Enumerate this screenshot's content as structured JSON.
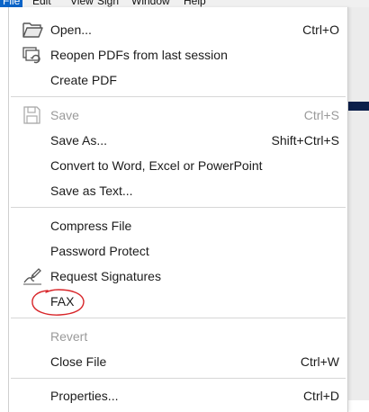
{
  "menubar": {
    "items": [
      "File",
      "Edit",
      "View",
      "Sign",
      "Window",
      "Help"
    ],
    "active": "File"
  },
  "menu": {
    "open": {
      "label": "Open...",
      "shortcut": "Ctrl+O",
      "icon": "folder-open-icon"
    },
    "reopen": {
      "label": "Reopen PDFs from last session",
      "icon": "reopen-pdfs-icon"
    },
    "create_pdf": {
      "label": "Create PDF"
    },
    "save": {
      "label": "Save",
      "shortcut": "Ctrl+S",
      "icon": "save-icon",
      "disabled": true
    },
    "save_as": {
      "label": "Save As...",
      "shortcut": "Shift+Ctrl+S"
    },
    "convert": {
      "label": "Convert to Word, Excel or PowerPoint"
    },
    "save_as_text": {
      "label": "Save as Text..."
    },
    "compress": {
      "label": "Compress File"
    },
    "password": {
      "label": "Password Protect"
    },
    "request_signatures": {
      "label": "Request Signatures",
      "icon": "signature-pen-icon"
    },
    "fax": {
      "label": "FAX"
    },
    "revert": {
      "label": "Revert",
      "disabled": true
    },
    "close_file": {
      "label": "Close File",
      "shortcut": "Ctrl+W"
    },
    "properties": {
      "label": "Properties...",
      "shortcut": "Ctrl+D"
    }
  },
  "colors": {
    "menubar_active": "#0a64c8",
    "disabled_text": "#9a9a9a",
    "annotation": "#d8262a"
  }
}
